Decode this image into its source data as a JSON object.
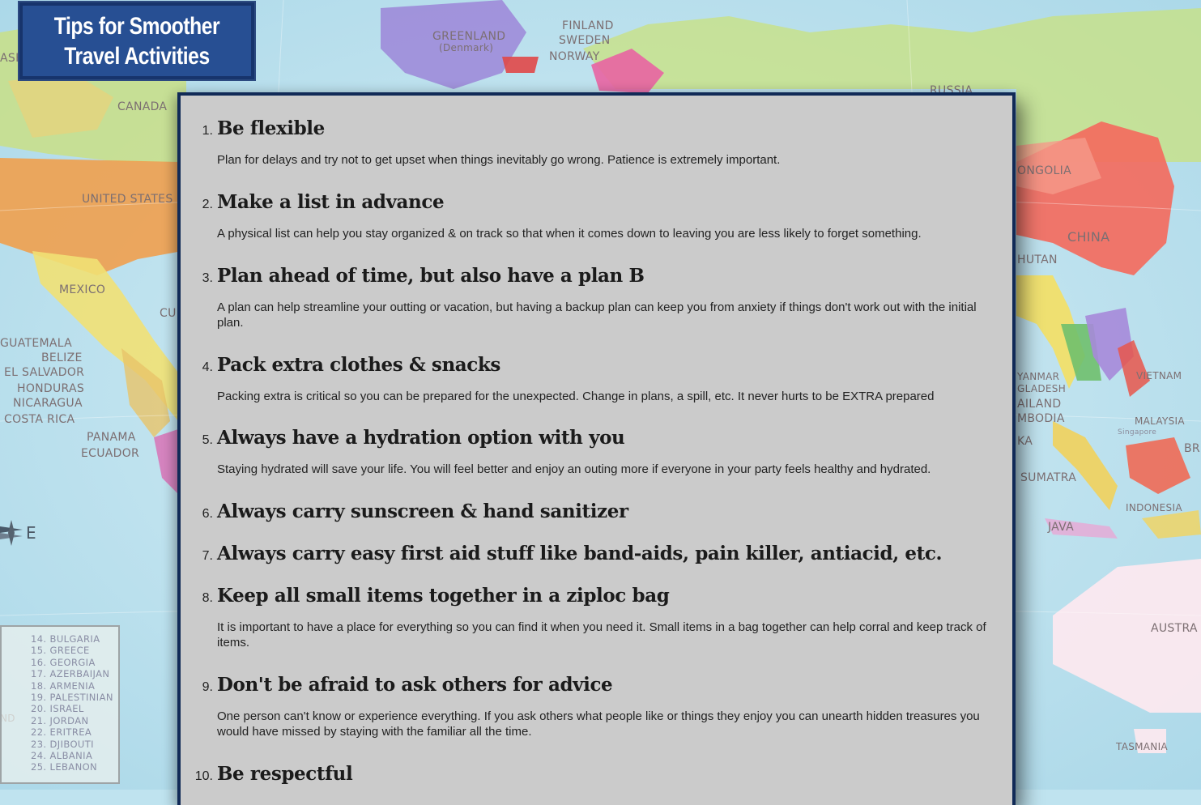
{
  "title_badge": {
    "line1": "Tips for Smoother",
    "line2": "Travel Activities"
  },
  "map": {
    "labels": {
      "greenland": "GREENLAND",
      "denmark": "(Denmark)",
      "finland": "FINLAND",
      "sweden": "SWEDEN",
      "norway": "NORWAY",
      "russia": "RUSSIA",
      "canada": "CANADA",
      "united_states": "UNITED STATES",
      "mexico": "MEXICO",
      "cuba": "CU",
      "guatemala": "GUATEMALA",
      "belize": "BELIZE",
      "el_salvador": "EL SALVADOR",
      "honduras": "HONDURAS",
      "nicaragua": "NICARAGUA",
      "costa_rica": "COSTA RICA",
      "panama": "PANAMA",
      "ecuador": "ECUADOR",
      "mongolia": "ONGOLIA",
      "china": "CHINA",
      "bhutan": "HUTAN",
      "myanmar": "YANMAR",
      "bangladesh": "GLADESH",
      "thailand": "AILAND",
      "cambodia": "MBODIA",
      "lanka": "KA",
      "vietnam": "VIETNAM",
      "malaysia": "MALAYSIA",
      "singapore": "Singapore",
      "brunei": "BRU",
      "sumatra": "SUMATRA",
      "indonesia": "INDONESIA",
      "java": "JAVA",
      "australia": "AUSTRA",
      "tasmania": "TASMANIA",
      "ask": "ASK",
      "nd": "ND",
      "compass_e": "E"
    },
    "legend": [
      "14. BULGARIA",
      "15. GREECE",
      "16. GEORGIA",
      "17. AZERBAIJAN",
      "18. ARMENIA",
      "19. PALESTINIAN",
      "20. ISRAEL",
      "21. JORDAN",
      "22. ERITREA",
      "23. DJIBOUTI",
      "24. ALBANIA",
      "25. LEBANON"
    ]
  },
  "tips": [
    {
      "number": "1.",
      "title": "Be flexible",
      "description": "Plan for delays and try not to get upset when things inevitably go wrong. Patience is extremely important."
    },
    {
      "number": "2.",
      "title": "Make a list in advance",
      "description": "A physical list can help you stay organized & on track so that when it comes down to leaving you are less likely to forget something."
    },
    {
      "number": "3.",
      "title": "Plan ahead of time, but also have a plan B",
      "description": "A plan can help streamline your outting or vacation, but having a backup plan can keep you from anxiety if things don't work out with the initial plan."
    },
    {
      "number": "4.",
      "title": "Pack extra clothes & snacks",
      "description": "Packing extra is critical so you can be prepared for the unexpected. Change in plans, a spill, etc. It never hurts to be EXTRA prepared"
    },
    {
      "number": "5.",
      "title": "Always have a hydration option with you",
      "description": "Staying hydrated will save your life. You will feel better and enjoy an outing more if everyone in your party feels healthy and hydrated."
    },
    {
      "number": "6.",
      "title": "Always carry sunscreen & hand sanitizer",
      "description": ""
    },
    {
      "number": "7.",
      "title": "Always carry easy first aid stuff like band-aids, pain killer, antiacid, etc.",
      "description": ""
    },
    {
      "number": "8.",
      "title": "Keep all small items together in a ziploc bag",
      "description": "It is important to have a place for everything so you can find it when you need it. Small items in a bag together can help corral and keep track of items."
    },
    {
      "number": "9.",
      "title": "Don't be afraid to ask others for advice",
      "description": "One person can't know or experience everything. If you ask others what people like or things they enjoy you can unearth hidden treasures you would have missed by staying with the familiar all the time."
    },
    {
      "number": "10.",
      "title": "Be respectful",
      "description": ""
    }
  ]
}
